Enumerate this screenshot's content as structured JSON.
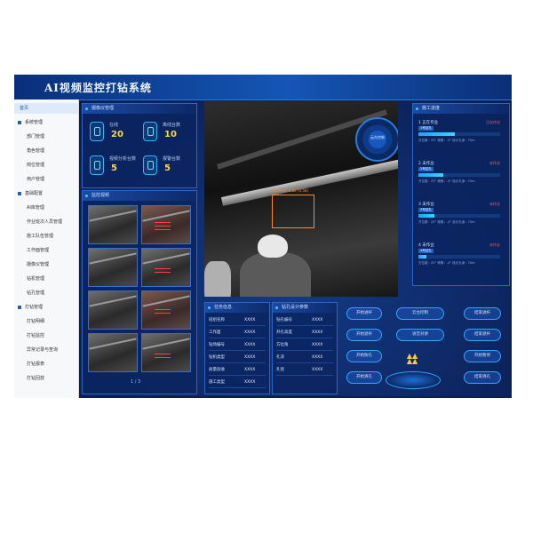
{
  "window": {
    "title": "AI视频监控打钻系统"
  },
  "sidebar": {
    "items": [
      {
        "label": "首页",
        "active": true,
        "group": false
      },
      {
        "label": "系统管理",
        "active": false,
        "group": true
      },
      {
        "label": "部门管理",
        "active": false,
        "group": false
      },
      {
        "label": "角色管理",
        "active": false,
        "group": false
      },
      {
        "label": "岗位管理",
        "active": false,
        "group": false
      },
      {
        "label": "用户管理",
        "active": false,
        "group": false
      },
      {
        "label": "基础配置",
        "active": false,
        "group": true
      },
      {
        "label": "AI库管理",
        "active": false,
        "group": false
      },
      {
        "label": "作业班次人员管理",
        "active": false,
        "group": false
      },
      {
        "label": "施工队伍管理",
        "active": false,
        "group": false
      },
      {
        "label": "工作面管理",
        "active": false,
        "group": false
      },
      {
        "label": "摄像仪管理",
        "active": false,
        "group": false
      },
      {
        "label": "钻机管理",
        "active": false,
        "group": false
      },
      {
        "label": "钻孔管理",
        "active": false,
        "group": false
      },
      {
        "label": "打钻管理",
        "active": false,
        "group": true
      },
      {
        "label": "打钻明细",
        "active": false,
        "group": false
      },
      {
        "label": "打钻监控",
        "active": false,
        "group": false
      },
      {
        "label": "异常记录与查询",
        "active": false,
        "group": false
      },
      {
        "label": "打钻报表",
        "active": false,
        "group": false
      },
      {
        "label": "打钻回放",
        "active": false,
        "group": false
      }
    ]
  },
  "camera_panel": {
    "title": "摄像仪管理",
    "stats": [
      {
        "label": "在线",
        "value": "20"
      },
      {
        "label": "离线台数",
        "value": "10"
      },
      {
        "label": "视频分析台数",
        "value": "5"
      },
      {
        "label": "报警台数",
        "value": "5"
      }
    ]
  },
  "monitor_panel": {
    "title": "监控视频",
    "pager": "1 / 3"
  },
  "video": {
    "detection_label": "8.person 0.82 (0.58)",
    "control_label": "云台控制"
  },
  "progress_panel": {
    "title": "施工进度",
    "items": [
      {
        "name": "1 正在作业",
        "status": "正在作业",
        "hole": "1号钻孔",
        "percent": 45,
        "info": "方位角：25°  倾角：-4°  设计孔深：70m"
      },
      {
        "name": "2 未作业",
        "status": "未作业",
        "hole": "2号钻孔",
        "percent": 30,
        "info": "方位角：25°  倾角：-4°  设计孔深：70m"
      },
      {
        "name": "3 未作业",
        "status": "未作业",
        "hole": "3号钻孔",
        "percent": 20,
        "info": "方位角：25°  倾角：-4°  设计孔深：70m"
      },
      {
        "name": "4 未作业",
        "status": "未作业",
        "hole": "4号钻孔",
        "percent": 10,
        "info": "方位角：25°  倾角：-4°  设计孔深：70m"
      }
    ]
  },
  "task_panel": {
    "title": "任务信息",
    "rows": [
      {
        "k": "班组名称",
        "v": "XXXX"
      },
      {
        "k": "工作面",
        "v": "XXXX"
      },
      {
        "k": "钻场编号",
        "v": "XXXX"
      },
      {
        "k": "钻机类型",
        "v": "XXXX"
      },
      {
        "k": "质量验收",
        "v": "XXXX"
      },
      {
        "k": "施工类型",
        "v": "XXXX"
      }
    ]
  },
  "design_panel": {
    "title": "钻孔设计参数",
    "rows": [
      {
        "k": "钻孔编号",
        "v": "XXXX"
      },
      {
        "k": "开孔高度",
        "v": "XXXX"
      },
      {
        "k": "方位角",
        "v": "XXXX"
      },
      {
        "k": "孔深",
        "v": "XXXX"
      },
      {
        "k": "孔径",
        "v": "XXXX"
      }
    ]
  },
  "controls": {
    "left": [
      "开始进杆",
      "开始退杆",
      "开始防孔",
      "开始清孔"
    ],
    "center": [
      "云台控制",
      "语音对讲"
    ],
    "right": [
      "结束进杆",
      "结束退杆",
      "开始暂停",
      "结束清孔"
    ]
  },
  "colors": {
    "accent": "#2fa6ff",
    "stat_value": "#ffd54a",
    "alert": "#ff5c5c"
  }
}
